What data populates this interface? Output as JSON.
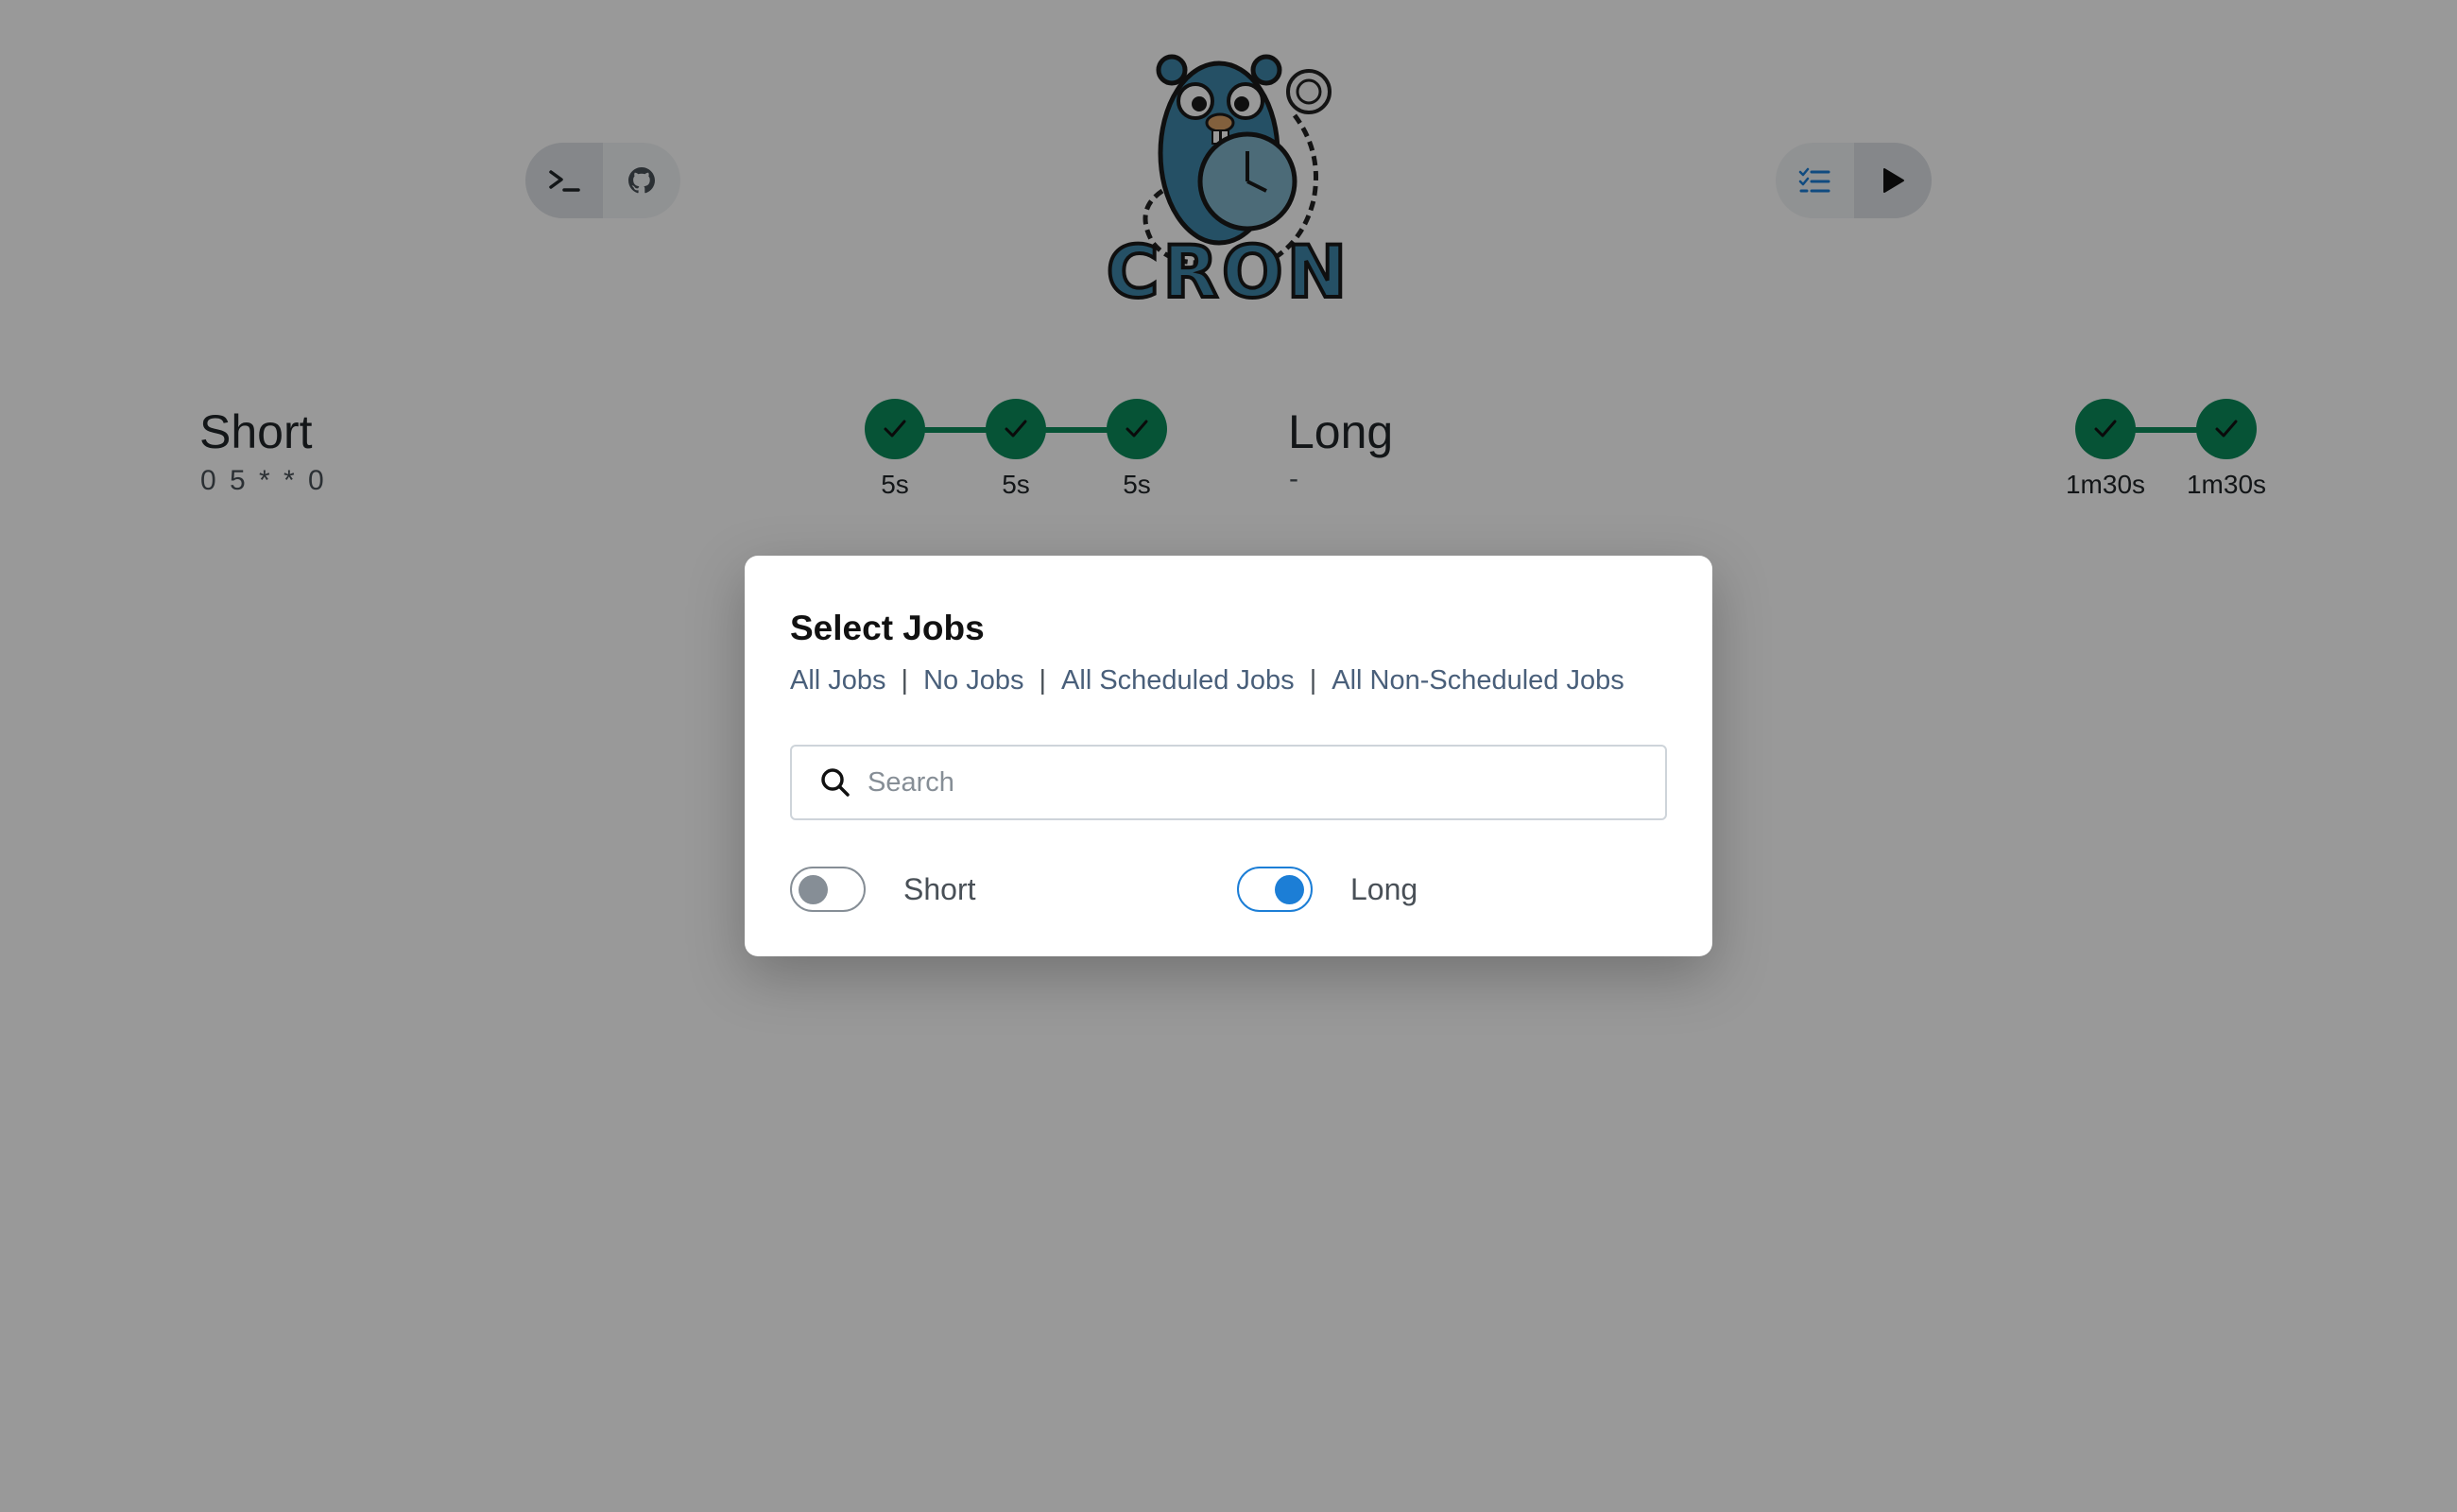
{
  "header": {
    "left_buttons": [
      {
        "icon": "terminal-icon"
      },
      {
        "icon": "github-icon"
      }
    ],
    "right_buttons": [
      {
        "icon": "checklist-icon"
      },
      {
        "icon": "play-icon"
      }
    ],
    "logo": {
      "wordmark": "CRON",
      "mascot": "gopher-with-stopwatch"
    }
  },
  "jobs": [
    {
      "name": "Short",
      "schedule": "0 5 * * 0",
      "runs": [
        {
          "status": "success",
          "duration": "5s"
        },
        {
          "status": "success",
          "duration": "5s"
        },
        {
          "status": "success",
          "duration": "5s"
        }
      ]
    },
    {
      "name": "Long",
      "schedule": "-",
      "runs": [
        {
          "status": "success",
          "duration": "1m30s"
        },
        {
          "status": "success",
          "duration": "1m30s"
        }
      ]
    }
  ],
  "modal": {
    "title": "Select Jobs",
    "links": [
      "All Jobs",
      "No Jobs",
      "All Scheduled Jobs",
      "All Non-Scheduled Jobs"
    ],
    "separator": "|",
    "search": {
      "placeholder": "Search",
      "value": ""
    },
    "toggles": [
      {
        "label": "Short",
        "checked": false
      },
      {
        "label": "Long",
        "checked": true
      }
    ]
  },
  "colors": {
    "success": "#0b8a5a",
    "accent": "#1c7ed6",
    "link": "#495f7a",
    "overlay": "rgba(0,0,0,0.4)"
  }
}
